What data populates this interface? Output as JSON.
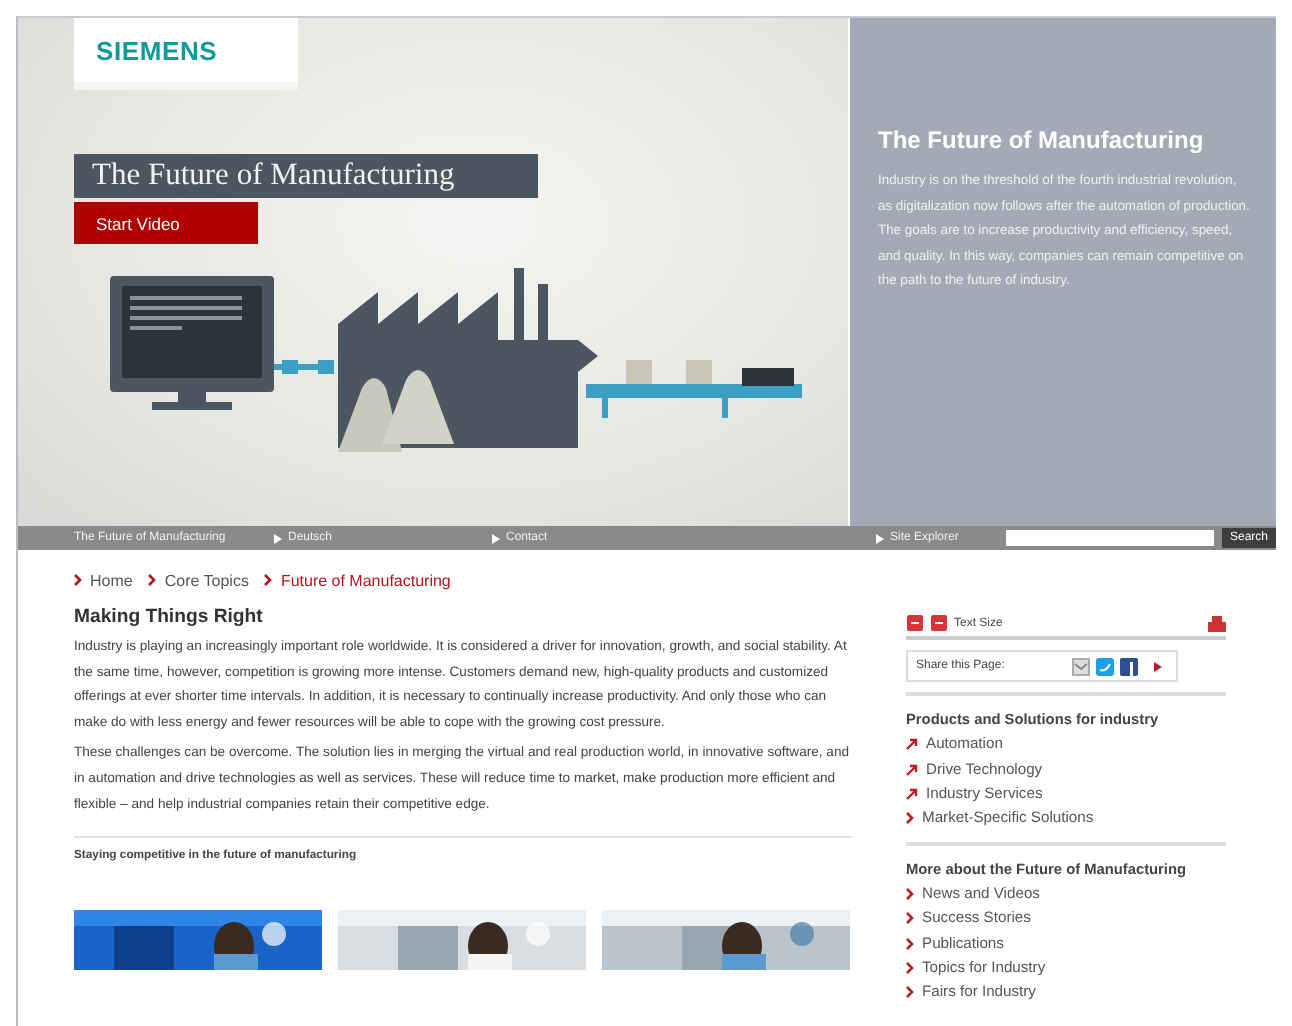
{
  "logo": "SIEMENS",
  "hero": {
    "title": "The Future of Manufacturing",
    "button": "Start Video",
    "side_title": "The Future of Manufacturing",
    "side_text": "Industry is on the threshold of the fourth industrial revolution, as digitalization now follows after the automation of production. The goals are to increase productivity and efficiency, speed, and quality. In this way, companies can remain competitive on the path to the future of industry."
  },
  "nav": {
    "items": [
      {
        "label": "The Future of Manufacturing",
        "arrow": false
      },
      {
        "label": "Deutsch",
        "arrow": true
      },
      {
        "label": "Contact",
        "arrow": true
      },
      {
        "label": "Site Explorer",
        "arrow": true
      }
    ],
    "search_button": "Search"
  },
  "breadcrumb": [
    {
      "label": "Home",
      "selected": false
    },
    {
      "label": "Core Topics",
      "selected": false
    },
    {
      "label": "Future of Manufacturing",
      "selected": true
    }
  ],
  "article": {
    "title": "Making Things Right",
    "paragraphs": [
      "Industry is playing an increasingly important role worldwide. It is considered a driver for innovation, growth, and social stability. At the same time, however, competition is growing more intense. Customers demand new, high-quality products and customized offerings at ever shorter time intervals. In addition, it is necessary to continually increase productivity. And only those who can make do with less energy and fewer resources will be able to cope with the growing cost pressure.",
      "These challenges can be overcome. The solution lies in merging the virtual and real production world, in innovative software, and in automation and drive technologies as well as services. These will reduce time to market, make production more efficient and flexible – and help industrial companies retain their competitive edge."
    ],
    "subheading": "Staying competitive in the future of manufacturing",
    "thumbnails": [
      {
        "kind": "picture"
      },
      {
        "kind": "picture"
      },
      {
        "kind": "picture"
      }
    ]
  },
  "sidebar": {
    "text_size": "Text Size",
    "share": "Share this Page:",
    "sections": [
      {
        "title": "Products and Solutions for industry",
        "links": [
          {
            "label": "Automation",
            "kind": "external"
          },
          {
            "label": "Drive Technology",
            "kind": "external"
          },
          {
            "label": "Industry Services",
            "kind": "external"
          },
          {
            "label": "Market-Specific Solutions",
            "kind": "internal"
          }
        ]
      },
      {
        "title": "More about the Future of Manufacturing",
        "links": [
          {
            "label": "News and Videos",
            "kind": "internal"
          },
          {
            "label": "Success Stories",
            "kind": "internal"
          },
          {
            "label": "Publications",
            "kind": "internal"
          },
          {
            "label": "Topics for Industry",
            "kind": "internal"
          },
          {
            "label": "Fairs for Industry",
            "kind": "internal"
          }
        ]
      }
    ]
  }
}
